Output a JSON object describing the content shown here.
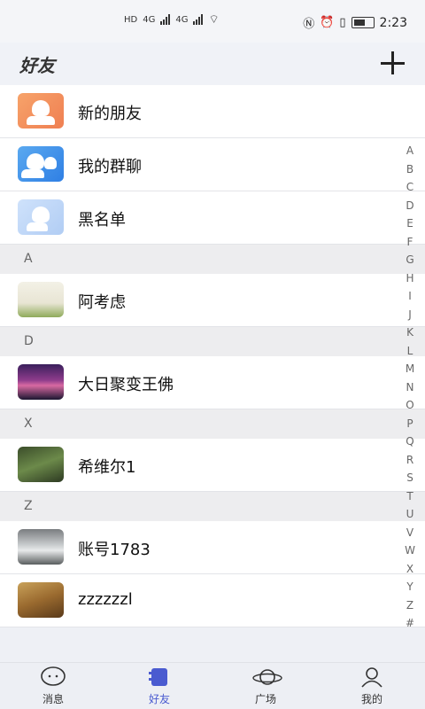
{
  "status": {
    "left_hd": "HD",
    "net1": "4G",
    "net2": "4G",
    "time": "2:23"
  },
  "header": {
    "title": "好友"
  },
  "functions": [
    {
      "label": "新的朋友",
      "icon": "new-friend-icon"
    },
    {
      "label": "我的群聊",
      "icon": "group-chat-icon"
    },
    {
      "label": "黑名单",
      "icon": "blacklist-icon"
    }
  ],
  "sections": [
    {
      "letter": "A",
      "contacts": [
        {
          "name": "阿考虑"
        }
      ]
    },
    {
      "letter": "D",
      "contacts": [
        {
          "name": "大日聚变王佛"
        }
      ]
    },
    {
      "letter": "X",
      "contacts": [
        {
          "name": "希维尔1"
        }
      ]
    },
    {
      "letter": "Z",
      "contacts": [
        {
          "name": "账号1783"
        },
        {
          "name": "zzzzzzl"
        }
      ]
    }
  ],
  "alphabet": [
    "A",
    "B",
    "C",
    "D",
    "E",
    "F",
    "G",
    "H",
    "I",
    "J",
    "K",
    "L",
    "M",
    "N",
    "O",
    "P",
    "Q",
    "R",
    "S",
    "T",
    "U",
    "V",
    "W",
    "X",
    "Y",
    "Z",
    "#"
  ],
  "tabs": [
    {
      "label": "消息",
      "icon": "message-icon"
    },
    {
      "label": "好友",
      "icon": "friends-icon",
      "active": true
    },
    {
      "label": "广场",
      "icon": "planet-icon"
    },
    {
      "label": "我的",
      "icon": "profile-icon"
    }
  ],
  "colors": {
    "accent": "#4a5bd0",
    "orange": "#ef7f52",
    "blue": "#2f7fe4",
    "light_blue": "#b1cdf4"
  }
}
